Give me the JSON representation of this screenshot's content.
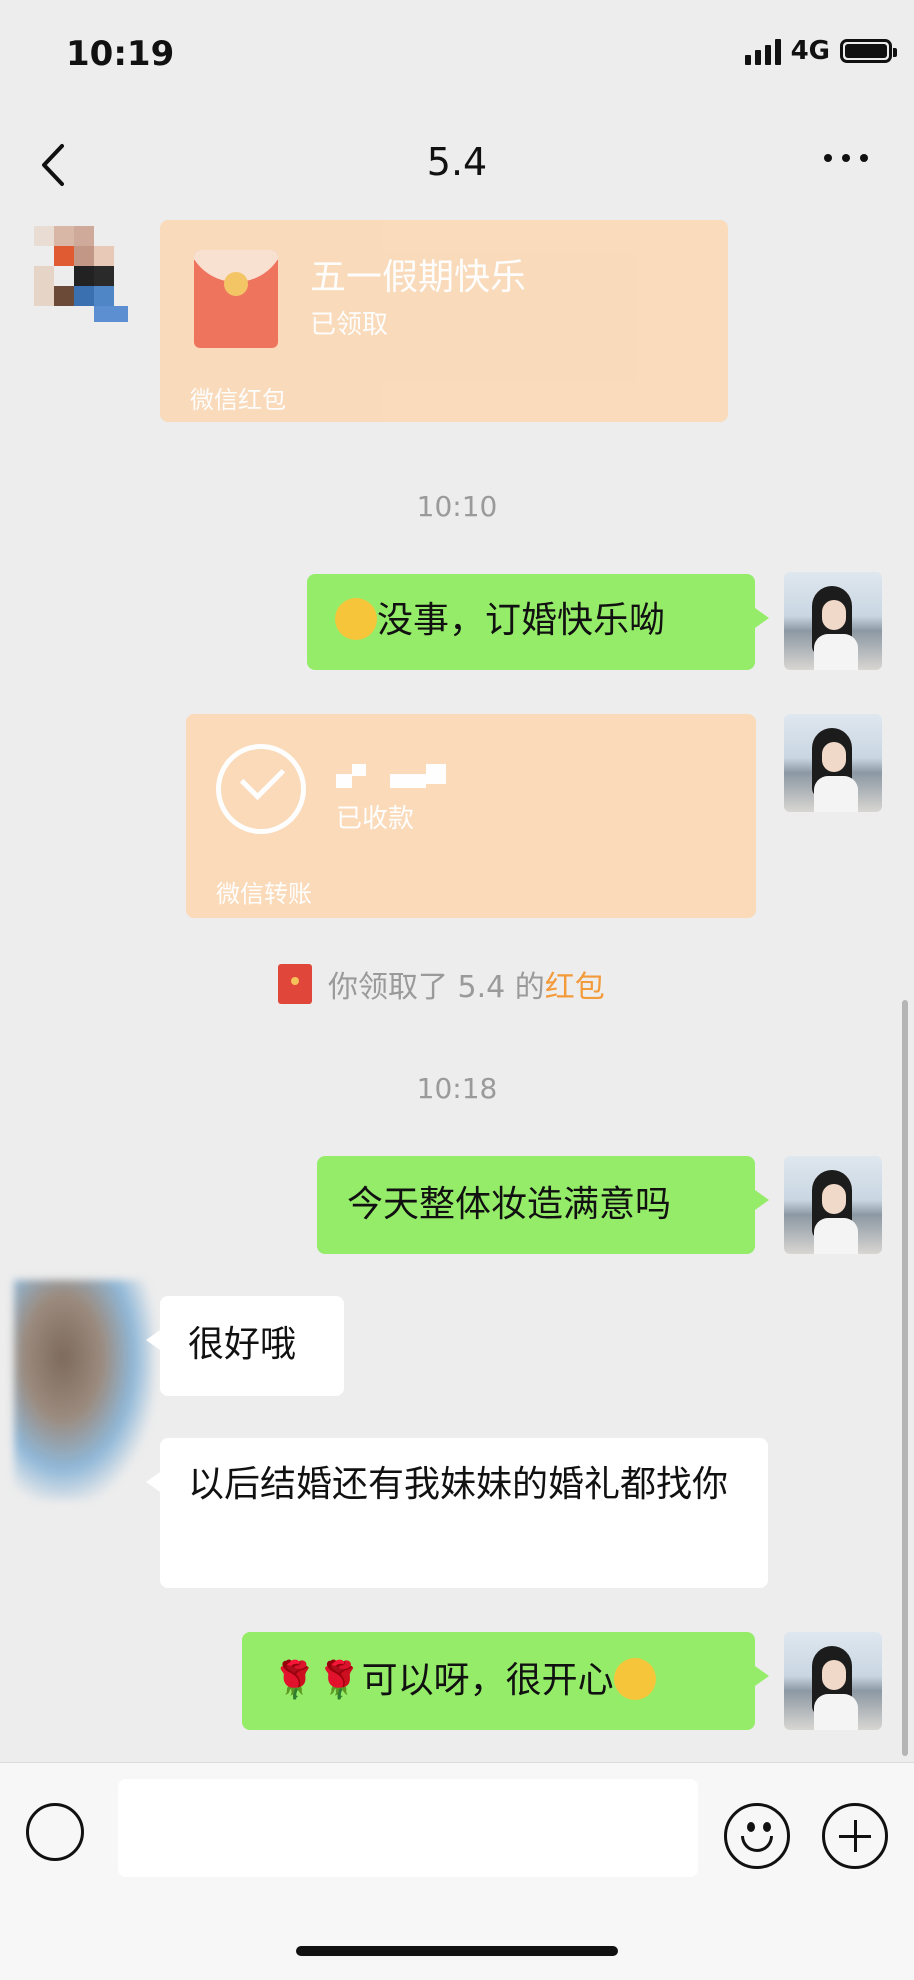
{
  "status_bar": {
    "time": "10:19",
    "network": "4G"
  },
  "header": {
    "title": "5.4"
  },
  "messages": {
    "red_packet": {
      "title": "五一假期快乐",
      "status": "已领取",
      "footer": "微信红包"
    },
    "time_1": "10:10",
    "me_1": "没事，订婚快乐呦",
    "transfer": {
      "status": "已收款",
      "footer": "微信转账"
    },
    "notice": {
      "prefix": "你领取了 5.4 的",
      "link": "红包"
    },
    "time_2": "10:18",
    "me_2": "今天整体妆造满意吗",
    "other_1": "很好哦",
    "other_2": "以后结婚还有我妹妹的婚礼都找你",
    "me_3": "可以呀，很开心"
  },
  "input": {
    "placeholder": ""
  },
  "icons": {
    "back": "chevron-left-icon",
    "more": "more-dots-icon",
    "voice": "voice-icon",
    "emoji": "emoji-icon",
    "plus": "plus-icon"
  },
  "colors": {
    "my_bubble": "#95ec69",
    "background": "#ededed",
    "red_packet": "#fbd9b6",
    "link": "#f39a3a"
  }
}
